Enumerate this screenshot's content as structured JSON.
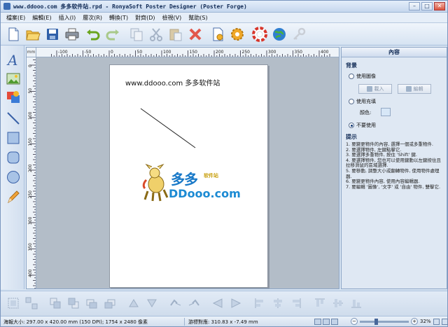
{
  "window": {
    "title": "www.ddooo.com 多多软件站.rpd - RonyaSoft Poster Designer (Poster Forge)",
    "buttons": {
      "minimize": "–",
      "maximize": "□",
      "close": "✕"
    }
  },
  "menu": {
    "items": [
      "檔案(E)",
      "編輯(E)",
      "插入(I)",
      "層次(R)",
      "轉換(T)",
      "對齊(D)",
      "檢視(V)",
      "幫助(S)"
    ]
  },
  "toolbar": {
    "icons": [
      "new-icon",
      "open-icon",
      "save-icon",
      "print-icon",
      "undo-icon",
      "redo-icon",
      "copy-icon",
      "cut-icon",
      "paste-icon",
      "delete-icon",
      "properties-icon",
      "settings-icon",
      "help-icon",
      "web-icon",
      "key-icon"
    ]
  },
  "left_tools": {
    "icons": [
      "text-tool-icon",
      "image-tool-icon",
      "clipart-tool-icon",
      "line-tool-icon",
      "rectangle-tool-icon",
      "rounded-rectangle-tool-icon",
      "ellipse-tool-icon",
      "pencil-tool-icon"
    ]
  },
  "rulers": {
    "unit": "mm",
    "top_labels": [
      "-100",
      "-50",
      "0",
      "50",
      "100",
      "150",
      "200",
      "250",
      "300",
      "350",
      "400"
    ],
    "left_labels": [
      "0",
      "50",
      "100",
      "150",
      "200",
      "250",
      "300",
      "350",
      "400"
    ]
  },
  "document": {
    "text_line": "www.ddooo.com 多多软件站",
    "logo_cn": "多多",
    "logo_cn_sub": "软件站",
    "logo_en": "DDooo.com"
  },
  "right_panel": {
    "header": "內容",
    "background_section": "背景",
    "use_image": "使用圖像",
    "load_button": "載入",
    "edit_button": "編輯",
    "use_fill": "使用充填",
    "color_label": "顏色:",
    "no_background": "不要使用",
    "tips_title": "提示",
    "tips": [
      "1. 要變更物件的內容, 選擇一個或多重物件.",
      "2. 要選擇物件, 左鍵點擊它.",
      "3. 要選擇多重物件, 按住 'Shift' 鍵.",
      "4. 要選擇物件, 您也可以使用鍵動以左鍵按住且拉移滑鼠的區域選擇.",
      "5. 要移動, 調整大小或翻轉物件, 使用物件處理器.",
      "6. 要變更物件內容, 使用內容編輯器.",
      "7. 要編輯 '圖像', '文字' 或 '自由' 物件, 雙擊它."
    ]
  },
  "bottom_toolbar": {
    "icons": [
      "group-icon",
      "ungroup-icon",
      "bring-front-icon",
      "send-back-icon",
      "bring-forward-icon",
      "send-backward-icon",
      "rotate-left-icon",
      "rotate-right-icon",
      "flip-h-icon",
      "flip-v-icon",
      "align-left-icon",
      "align-center-icon",
      "align-right-icon",
      "align-top-icon",
      "align-middle-icon",
      "align-bottom-icon",
      "distribute-h-icon",
      "distribute-v-icon"
    ]
  },
  "status": {
    "paper_size": "海報大小: 297.00 x 420.00 mm (150 DPI); 1754 x 2480 像素",
    "cursor_pos": "游標對應: 310.83 x -7.49 mm",
    "zoom": "32%",
    "zoom_value": 0.32
  }
}
